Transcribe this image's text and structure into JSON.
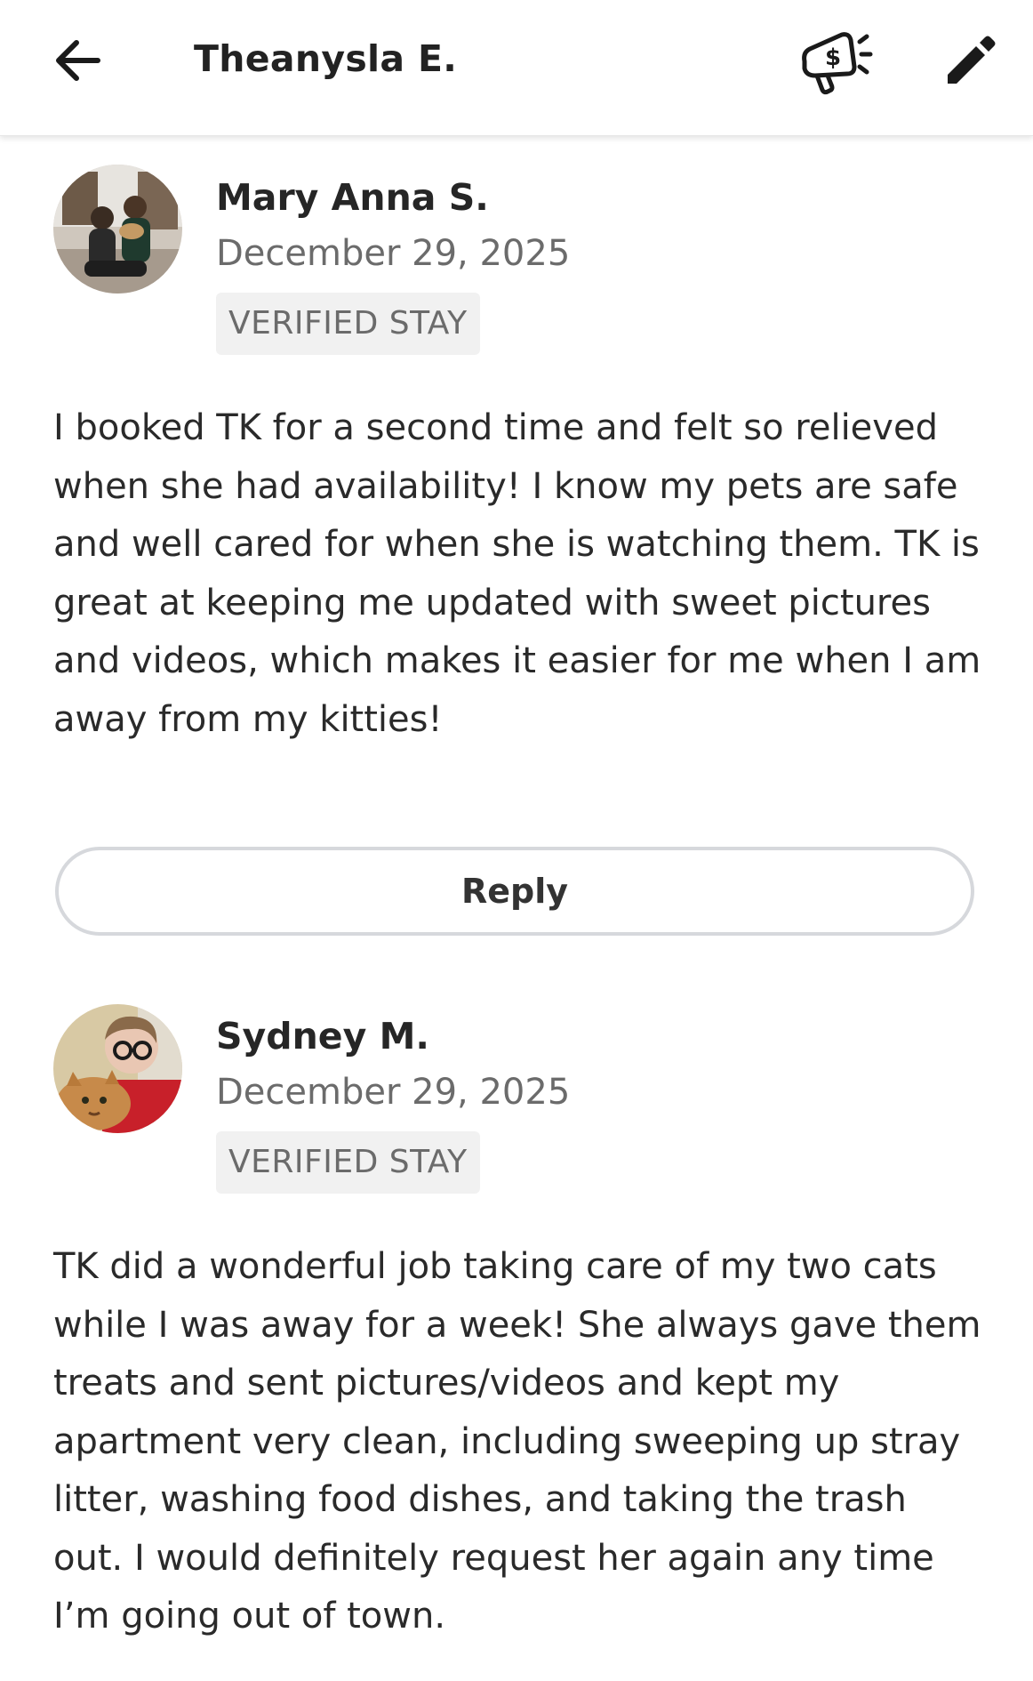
{
  "header": {
    "title": "Theanysla E.",
    "icons": {
      "back": "arrow-left-icon",
      "promo": "megaphone-dollar-icon",
      "edit": "pencil-icon"
    }
  },
  "reviews": [
    {
      "name": "Mary Anna S.",
      "date": "December 29, 2025",
      "badge": "VERIFIED STAY",
      "text": "I booked TK for a second time and felt so relieved when she had availability! I know my pets  are safe and well cared for when she is watching them. TK is great at keeping me updated with sweet pictures and videos, which makes it easier for me when I am away from my kitties!",
      "reply_label": "Reply"
    },
    {
      "name": "Sydney M.",
      "date": "December 29, 2025",
      "badge": "VERIFIED STAY",
      "text": "TK did a wonderful job taking care of my two cats while I was away for a week! She always gave them treats and sent pictures/videos and kept my apartment very clean, including sweeping up stray litter, washing food dishes, and taking the trash out. I would definitely request her again any time I’m going out of town."
    }
  ],
  "colors": {
    "text_primary": "#262626",
    "text_secondary": "#6b6b6b",
    "badge_bg": "#f1f1f1",
    "reply_border": "#d6d8dc"
  }
}
